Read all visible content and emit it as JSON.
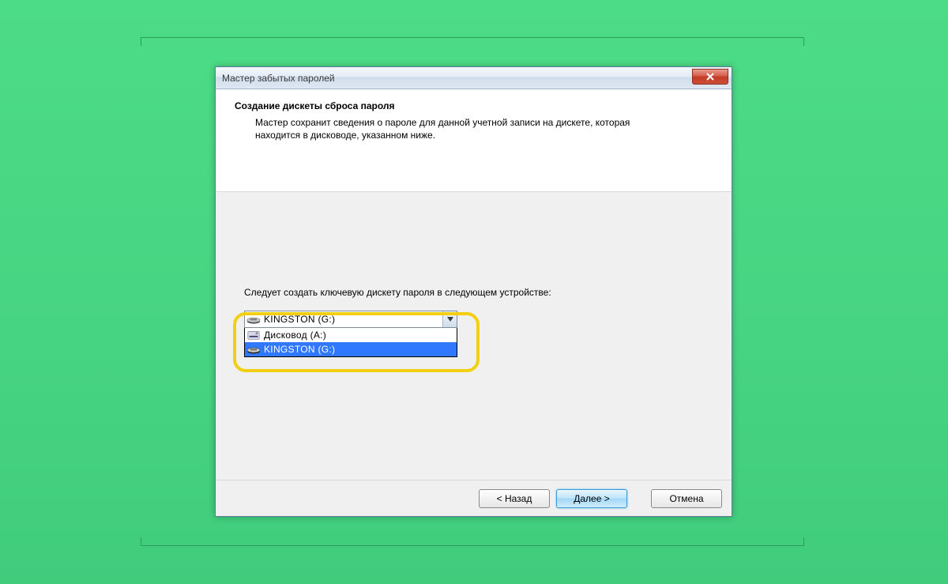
{
  "window": {
    "title": "Мастер забытых паролей"
  },
  "header": {
    "title": "Создание дискеты сброса пароля",
    "description": "Мастер сохранит сведения о пароле для данной учетной записи на дискете, которая находится в дисководе, указанном ниже."
  },
  "body": {
    "prompt": "Следует создать ключевую дискету пароля в следующем устройстве:",
    "combo_selected": "KINGSTON (G:)",
    "options": [
      {
        "label": "Дисковод (A:)",
        "icon": "floppy",
        "selected": false
      },
      {
        "label": "KINGSTON (G:)",
        "icon": "usb",
        "selected": true
      }
    ]
  },
  "footer": {
    "back": "< Назад",
    "next": "Далее >",
    "cancel": "Отмена"
  }
}
